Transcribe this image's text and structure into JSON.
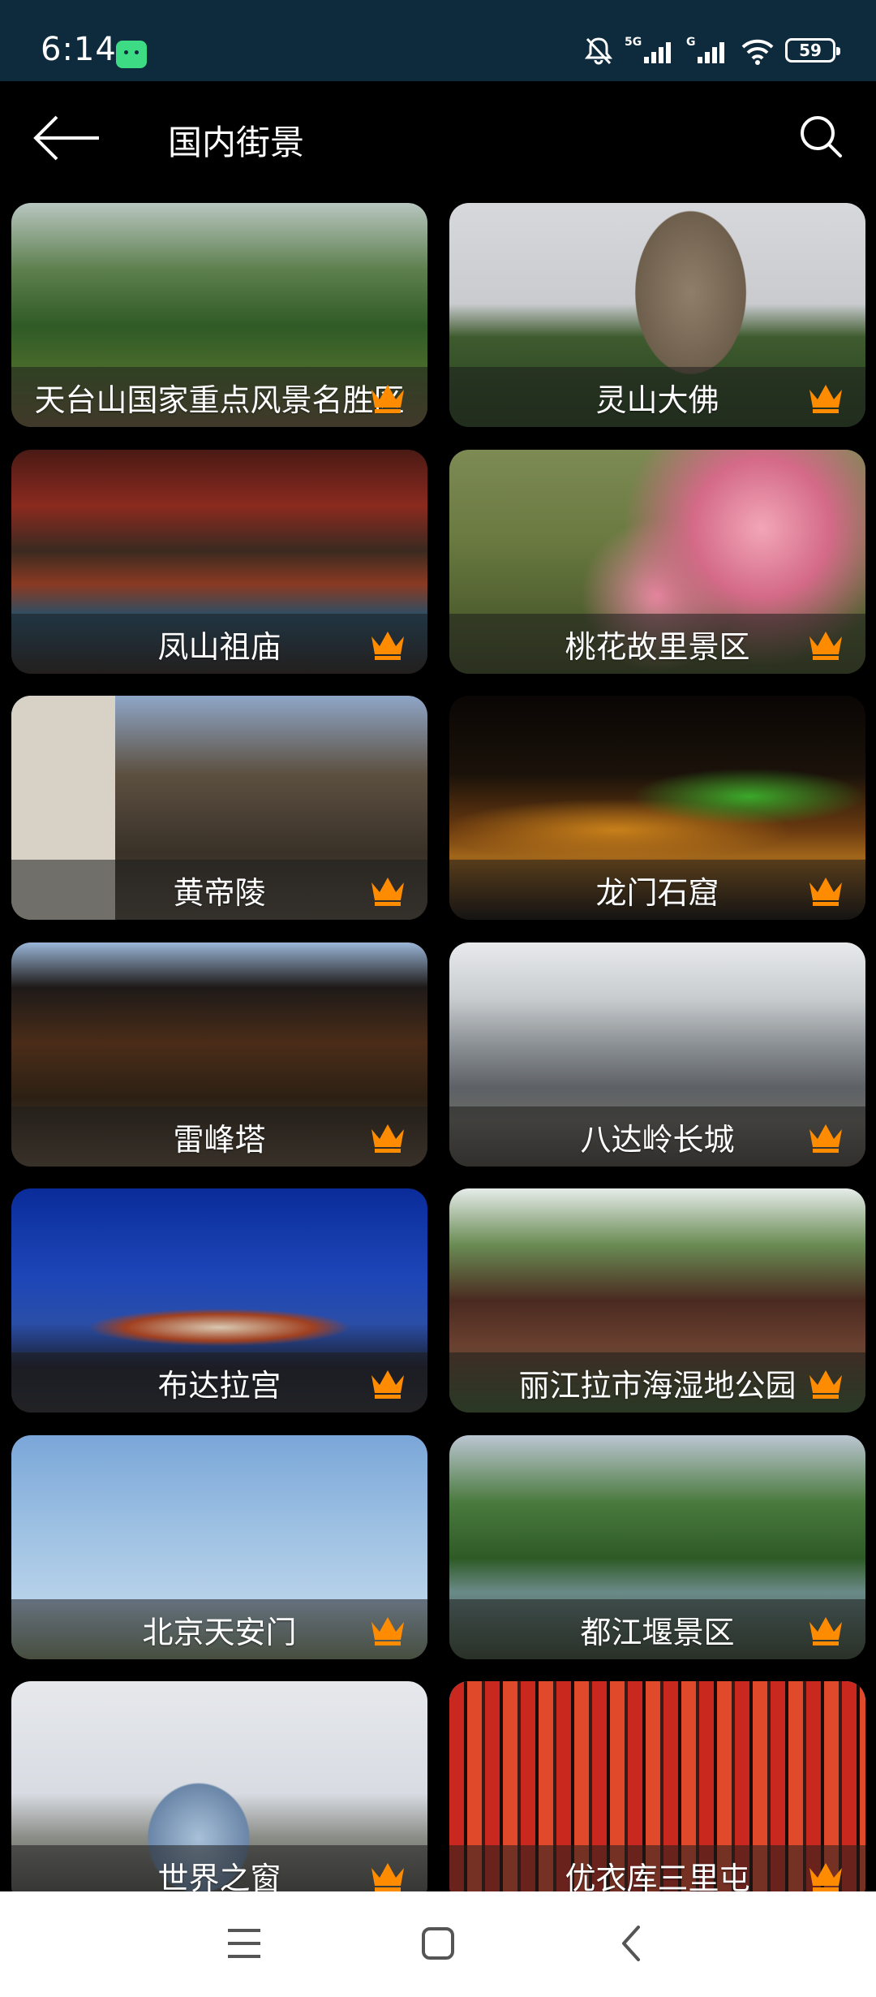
{
  "status_bar": {
    "time": "6:14",
    "network": "5G",
    "battery": "59"
  },
  "app_bar": {
    "title": "国内街景"
  },
  "accent_color": "#ff8c00",
  "places": [
    {
      "name": "天台山国家重点风景名胜区",
      "bg": "linear-gradient(180deg,#b8c6c0 0%,#5d7f4e 30%,#2f5a26 55%,#4a6b2c 75%,#6b5a3a 100%)"
    },
    {
      "name": "灵山大佛",
      "bg": "radial-gradient(ellipse 22% 60% at 58% 40%,#8f7f6a 0%,#6e5e4c 60%,transparent 61%),linear-gradient(180deg,#d6d8dc 0%,#c9cbcf 45%,#3e5a2e 60%,#26401d 100%)"
    },
    {
      "name": "凤山祖庙",
      "bg": "linear-gradient(180deg,#4a1a14 0%,#8b2a1f 25%,#3b2a20 45%,#8a3a22 60%,#25506a 75%,#2a2220 100%)"
    },
    {
      "name": "桃花故里景区",
      "bg": "radial-gradient(circle at 75% 35%,#f2a6b8 0%,#d46a88 20%,transparent 40%),radial-gradient(circle at 50% 65%,#e88aa3 0%,transparent 30%),linear-gradient(180deg,#7d8a54 0%,#6a7a40 40%,#3c4a22 100%)"
    },
    {
      "name": "黄帝陵",
      "bg": "linear-gradient(90deg,#d8d2c6 0% 25%,transparent 25%),linear-gradient(180deg,#8fa6c8 0%,#5c5040 35%,#3a3128 70%,#52483c 100%)"
    },
    {
      "name": "龙门石窟",
      "bg": "radial-gradient(ellipse 40% 18% at 72% 45%,#3aa82a 0%,transparent 70%),radial-gradient(ellipse 60% 20% at 40% 60%,#c8801a 0%,transparent 70%),linear-gradient(180deg,#0a0604 0%,#1a120a 35%,#6a3a10 60%,#a2661a 72%,#0c0a08 100%)"
    },
    {
      "name": "雷峰塔",
      "bg": "linear-gradient(180deg,#9ab6d8 0%,#1e1a18 20%,#4a2c18 45%,#2c2014 70%,#5a4a38 100%)"
    },
    {
      "name": "八达岭长城",
      "bg": "linear-gradient(180deg,#e8eaec 0%,#c8cccf 25%,#8d9296 45%,#5d6166 65%,#6b6a64 80%,#4a4640 100%)"
    },
    {
      "name": "布达拉宫",
      "bg": "radial-gradient(ellipse 45% 12% at 50% 62%,#d8c8b0 0%,#a04020 50%,transparent 70%),linear-gradient(180deg,#0a2c9a 0%,#1e46b8 40%,#2a4ea8 60%,#1a1e2e 80%,#2a2a30 100%)"
    },
    {
      "name": "丽江拉市海湿地公园",
      "bg": "linear-gradient(180deg,#e6ecea 0%,#6a8c54 25%,#4a2a20 50%,#6a4030 70%,#3a5a30 100%)"
    },
    {
      "name": "北京天安门",
      "bg": "linear-gradient(180deg,#7aa6d8 0%,#9cc0e2 40%,#b8d2ea 75%,#7a8a6a 100%)"
    },
    {
      "name": "都江堰景区",
      "bg": "linear-gradient(180deg,#bcc6d2 0%,#4a7a3e 30%,#2e5a26 55%,#6a8a88 70%,#3a4a36 100%)"
    },
    {
      "name": "世界之窗",
      "bg": "radial-gradient(ellipse 20% 40% at 45% 70%,#a8c0d8 0%,#6a86a8 60%,transparent 62%),linear-gradient(180deg,#e6e8ec 0%,#d8dce2 50%,#8a8c86 70%,#4a4a44 100%)"
    },
    {
      "name": "优衣库三里屯",
      "bg": "repeating-linear-gradient(90deg,#c8281e 0 18px,#1a0a08 18px 22px,#e04a2a 22px 40px,#3a1a14 40px 44px),linear-gradient(180deg,#d8e2f0 0%,#c8281e 100%)"
    }
  ],
  "nav": {
    "menu_icon": "menu-icon",
    "home_icon": "home-icon",
    "back_icon": "back-icon"
  }
}
